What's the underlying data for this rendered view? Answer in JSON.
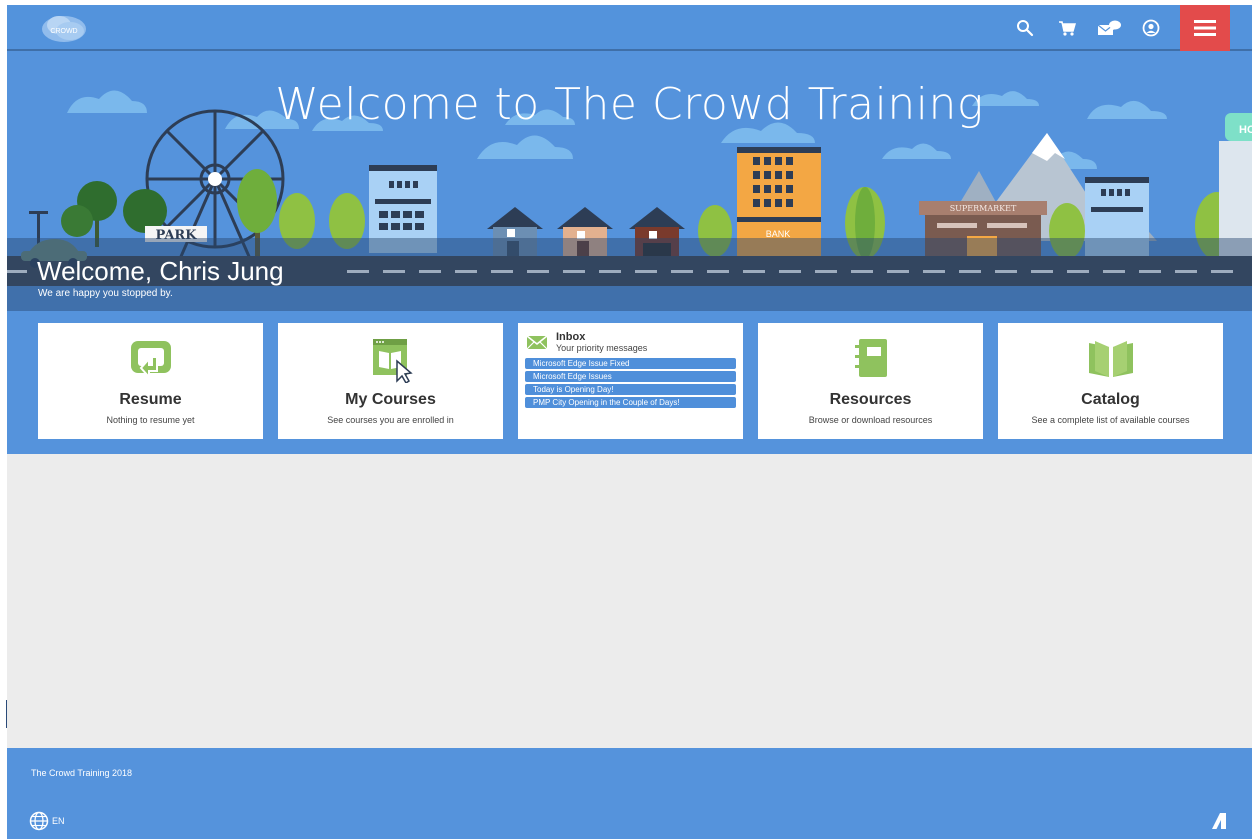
{
  "header": {
    "logo_text": "CROWD",
    "icons": [
      "search-icon",
      "cart-icon",
      "messages-icon",
      "profile-icon",
      "menu-icon"
    ],
    "accent_color": "#5393dc",
    "menu_color": "#e34b4b"
  },
  "hero": {
    "title": "Welcome to The Crowd Training",
    "welcome": "Welcome, Chris Jung",
    "subtitle": "We are happy you stopped by.",
    "signs": {
      "park": "PARK",
      "bank": "BANK",
      "supermarket": "SUPERMARKET",
      "partial": "HO"
    }
  },
  "tiles": [
    {
      "name": "Resume",
      "description": "Nothing to resume yet",
      "icon": "resume-icon"
    },
    {
      "name": "My Courses",
      "description": "See courses you are enrolled in",
      "icon": "courses-icon"
    },
    {
      "name": "Resources",
      "description": "Browse or download resources",
      "icon": "resources-icon"
    },
    {
      "name": "Catalog",
      "description": "See a complete list of available courses",
      "icon": "catalog-icon"
    }
  ],
  "inbox": {
    "title": "Inbox",
    "subtitle": "Your priority messages",
    "icon": "envelope-icon",
    "messages": [
      "Microsoft Edge Issue Fixed",
      "Microsoft Edge Issues",
      "Today is Opening Day!",
      "PMP City Opening in the Couple of Days!"
    ]
  },
  "footer": {
    "copyright": "The Crowd Training 2018",
    "language": "EN"
  }
}
